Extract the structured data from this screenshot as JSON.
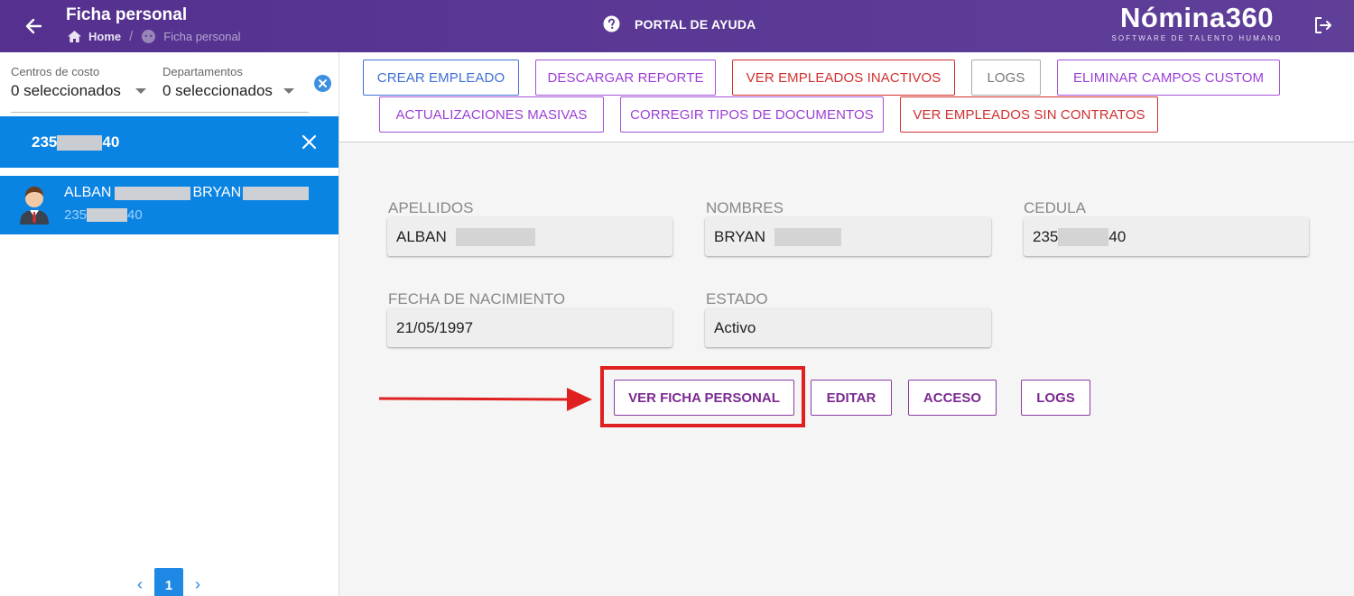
{
  "header": {
    "title": "Ficha personal",
    "breadcrumb": {
      "home": "Home",
      "current": "Ficha personal"
    },
    "help_label": "PORTAL DE AYUDA",
    "brand": {
      "name": "Nómina360",
      "tagline": "SOFTWARE DE TALENTO HUMANO"
    }
  },
  "sidebar": {
    "filters": [
      {
        "label": "Centros de costo",
        "value": "0 seleccionados"
      },
      {
        "label": "Departamentos",
        "value": "0 seleccionados"
      }
    ],
    "search": {
      "prefix": "235",
      "suffix": "40"
    },
    "employee": {
      "first": "ALBAN",
      "second": "BRYAN",
      "id_prefix": "235",
      "id_suffix": "40"
    },
    "pagination": {
      "current": "1"
    }
  },
  "toolbar": {
    "crear_empleado": "CREAR EMPLEADO",
    "descargar_reporte": "DESCARGAR REPORTE",
    "ver_inactivos": "VER EMPLEADOS INACTIVOS",
    "logs": "LOGS",
    "eliminar_campos": "ELIMINAR CAMPOS CUSTOM",
    "actualizaciones": "ACTUALIZACIONES MASIVAS",
    "corregir_tipos": "CORREGIR TIPOS DE DOCUMENTOS",
    "ver_sin_contratos": "VER EMPLEADOS SIN CONTRATOS"
  },
  "details": {
    "apellidos": {
      "label": "APELLIDOS",
      "value": "ALBAN"
    },
    "nombres": {
      "label": "NOMBRES",
      "value": "BRYAN"
    },
    "cedula": {
      "label": "CEDULA",
      "prefix": "235",
      "suffix": "40"
    },
    "fecha": {
      "label": "FECHA DE NACIMIENTO",
      "value": "21/05/1997"
    },
    "estado": {
      "label": "ESTADO",
      "value": "Activo"
    }
  },
  "employee_actions": {
    "ver_ficha": "VER FICHA PERSONAL",
    "editar": "EDITAR",
    "acceso": "ACCESO",
    "logs": "LOGS"
  },
  "colors": {
    "header": "#55308f",
    "selection": "#0a84e3",
    "highlight": "#e02020",
    "action_purple": "#7b2a90"
  }
}
